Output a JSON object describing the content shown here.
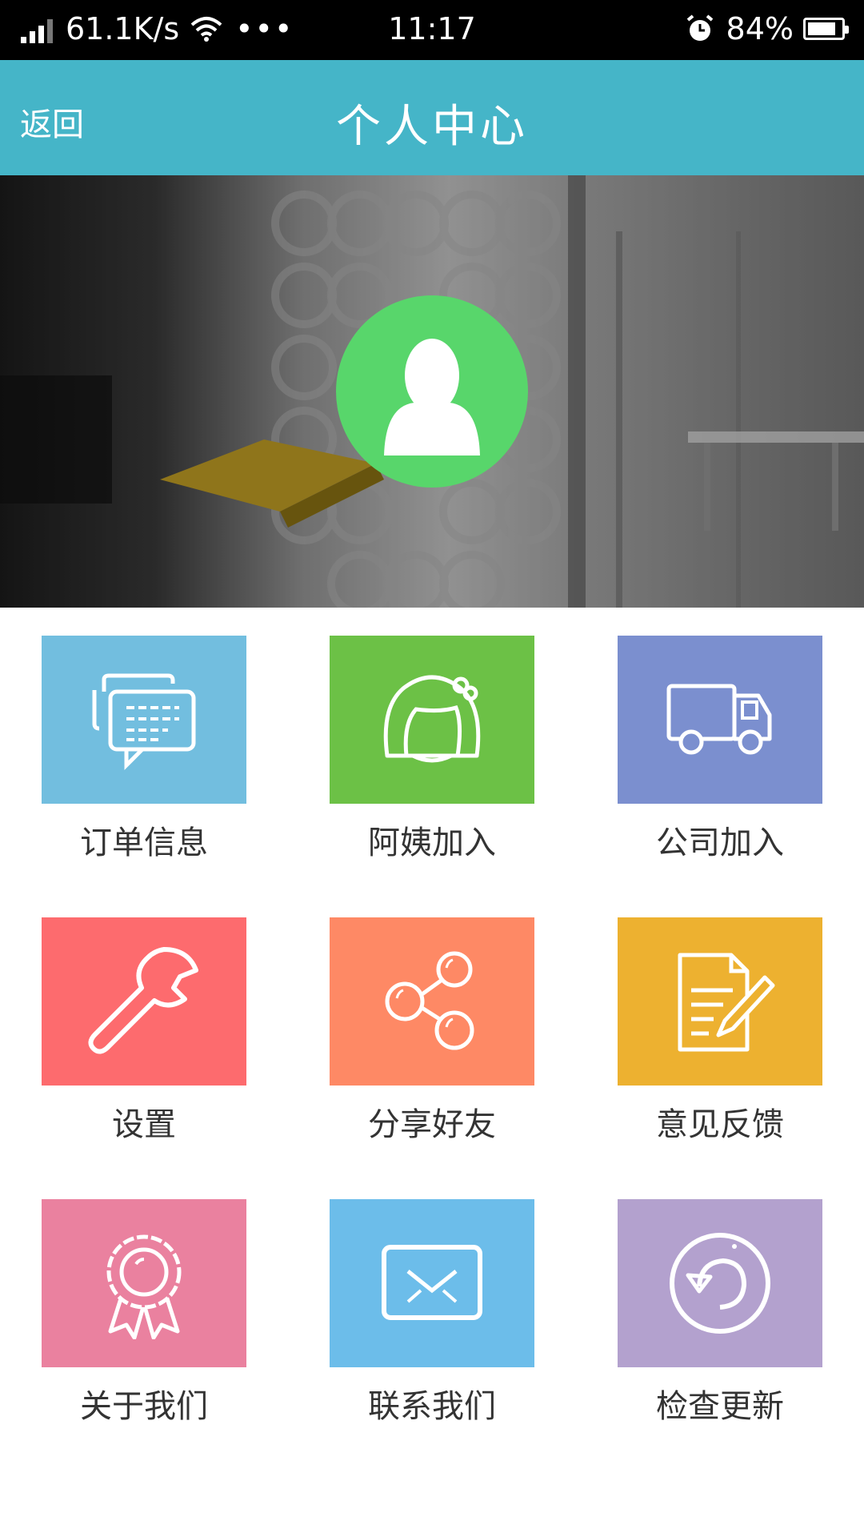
{
  "status_bar": {
    "net_speed": "61.1K/s",
    "dots": "•••",
    "time": "11:17",
    "battery": "84%",
    "battery_level": 0.84,
    "icons": [
      "signal-icon",
      "wifi-icon",
      "alarm-icon",
      "battery-icon"
    ]
  },
  "header": {
    "back": "返回",
    "title": "个人中心"
  },
  "banner": {
    "avatar_icon": "user-avatar-icon",
    "avatar_color": "#58d66b"
  },
  "menu": [
    {
      "label": "订单信息",
      "icon": "chat-message-icon",
      "color": "#72bedf"
    },
    {
      "label": "阿姨加入",
      "icon": "girl-face-icon",
      "color": "#6cc146"
    },
    {
      "label": "公司加入",
      "icon": "truck-icon",
      "color": "#7b8fcf"
    },
    {
      "label": "设置",
      "icon": "wrench-icon",
      "color": "#fd6b6e"
    },
    {
      "label": "分享好友",
      "icon": "share-icon",
      "color": "#fe8965"
    },
    {
      "label": "意见反馈",
      "icon": "document-edit-icon",
      "color": "#edb130"
    },
    {
      "label": "关于我们",
      "icon": "award-ribbon-icon",
      "color": "#ea819f"
    },
    {
      "label": "联系我们",
      "icon": "mail-icon",
      "color": "#6cbdea"
    },
    {
      "label": "检查更新",
      "icon": "refresh-circle-icon",
      "color": "#b3a1ce"
    }
  ]
}
